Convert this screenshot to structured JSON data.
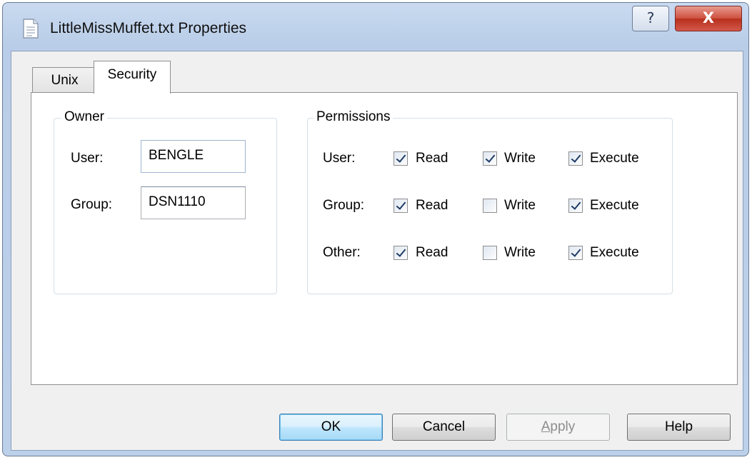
{
  "window": {
    "title": "LittleMissMuffet.txt Properties",
    "help_glyph": "?",
    "close_glyph": "X"
  },
  "tabs": [
    {
      "label": "Unix",
      "selected": false
    },
    {
      "label": "Security",
      "selected": true
    }
  ],
  "owner": {
    "legend": "Owner",
    "user_label": "User:",
    "user_value": "BENGLE",
    "group_label": "Group:",
    "group_value": "DSN1110"
  },
  "permissions": {
    "legend": "Permissions",
    "read_label": "Read",
    "write_label": "Write",
    "execute_label": "Execute",
    "rows": [
      {
        "label": "User:",
        "read": true,
        "write": true,
        "execute": true
      },
      {
        "label": "Group:",
        "read": true,
        "write": false,
        "execute": true
      },
      {
        "label": "Other:",
        "read": true,
        "write": false,
        "execute": true
      }
    ]
  },
  "buttons": {
    "ok": "OK",
    "cancel": "Cancel",
    "apply_first": "A",
    "apply_rest": "pply",
    "help": "Help"
  },
  "colors": {
    "title_bar": "#c9daf0",
    "close_button": "#cf5242",
    "default_button_border": "#3c7fb1"
  },
  "icons": {
    "title": "document-icon",
    "help": "question-mark-icon",
    "close": "close-x-icon"
  }
}
